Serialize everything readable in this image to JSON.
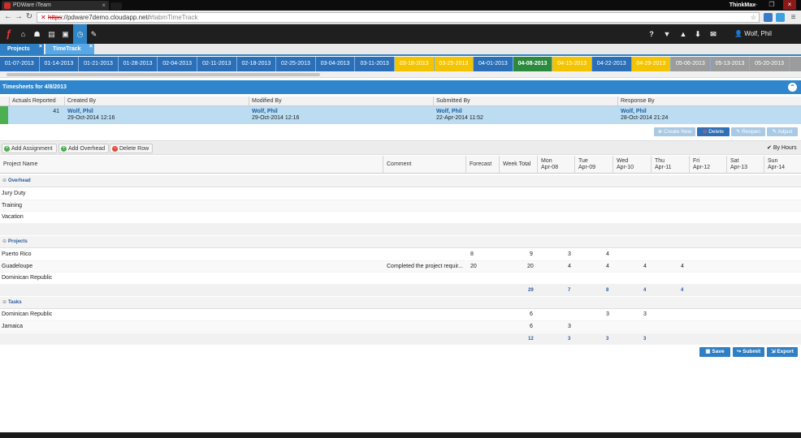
{
  "browser": {
    "tab_title": "PDWare iTeam",
    "profile": "ThinkMax",
    "url_scheme": "https",
    "url_host": "://pdware7demo.cloudapp.net/",
    "url_path": "#tabmTimeTrack"
  },
  "appnav": {
    "help": "?",
    "user": "Wolf, Phil"
  },
  "apptabs": [
    {
      "label": "Projects"
    },
    {
      "label": "TimeTrack"
    }
  ],
  "weeks": [
    {
      "label": "01-07-2013",
      "state": "blue"
    },
    {
      "label": "01-14-2013",
      "state": "blue"
    },
    {
      "label": "01-21-2013",
      "state": "blue"
    },
    {
      "label": "01-28-2013",
      "state": "blue"
    },
    {
      "label": "02-04-2013",
      "state": "blue"
    },
    {
      "label": "02-11-2013",
      "state": "blue"
    },
    {
      "label": "02-18-2013",
      "state": "blue"
    },
    {
      "label": "02-25-2013",
      "state": "blue"
    },
    {
      "label": "03-04-2013",
      "state": "blue"
    },
    {
      "label": "03-11-2013",
      "state": "blue"
    },
    {
      "label": "03-18-2013",
      "state": "yellow"
    },
    {
      "label": "03-25-2013",
      "state": "yellow"
    },
    {
      "label": "04-01-2013",
      "state": "blue"
    },
    {
      "label": "04-08-2013",
      "state": "green"
    },
    {
      "label": "04-15-2013",
      "state": "yellow"
    },
    {
      "label": "04-22-2013",
      "state": "blue"
    },
    {
      "label": "04-29-2013",
      "state": "yellow"
    },
    {
      "label": "05-06-2013",
      "state": "gray"
    },
    {
      "label": "05-13-2013",
      "state": "gray"
    },
    {
      "label": "05-20-2013",
      "state": "gray"
    },
    {
      "label": "05-2",
      "state": "gray"
    }
  ],
  "timesheet": {
    "title": "Timesheets for 4/8/2013",
    "headers": {
      "actuals": "Actuals Reported",
      "created": "Created By",
      "modified": "Modified By",
      "submitted": "Submitted By",
      "response": "Response By"
    },
    "row": {
      "actuals": "41",
      "created_by": "Wolf, Phil",
      "created_at": "29-Oct-2014 12:16",
      "modified_by": "Wolf, Phil",
      "modified_at": "29-Oct-2014 12:16",
      "submitted_by": "Wolf, Phil",
      "submitted_at": "22-Apr-2014 11:52",
      "response_by": "Wolf, Phil",
      "response_at": "28-Oct-2014 21:24"
    }
  },
  "actions": {
    "create_new": "Create New",
    "delete": "Delete",
    "reopen": "Reopen",
    "adjust": "Adjust"
  },
  "toolbar": {
    "add_assignment": "Add Assignment",
    "add_overhead": "Add Overhead",
    "delete_row": "Delete Row",
    "by_hours": "By Hours"
  },
  "grid": {
    "headers": {
      "project": "Project Name",
      "comment": "Comment",
      "forecast": "Forecast",
      "week_total": "Week Total"
    },
    "days": [
      {
        "dow": "Mon",
        "date": "Apr-08"
      },
      {
        "dow": "Tue",
        "date": "Apr-09"
      },
      {
        "dow": "Wed",
        "date": "Apr-10"
      },
      {
        "dow": "Thu",
        "date": "Apr-11"
      },
      {
        "dow": "Fri",
        "date": "Apr-12"
      },
      {
        "dow": "Sat",
        "date": "Apr-13"
      },
      {
        "dow": "Sun",
        "date": "Apr-14"
      }
    ],
    "groups": {
      "overhead": {
        "label": "Overhead",
        "rows": [
          {
            "name": "Jury Duty"
          },
          {
            "name": "Training"
          },
          {
            "name": "Vacation"
          }
        ]
      },
      "projects": {
        "label": "Projects",
        "rows": [
          {
            "name": "Puerto Rico",
            "comment": "",
            "forecast": "8",
            "total": "9",
            "mon": "",
            "tue": "3",
            "wed": "4",
            "thu": "",
            "fri": ""
          },
          {
            "name": "Guadeloupe",
            "comment": "Completed the project requir...",
            "forecast": "20",
            "total": "20",
            "mon": "",
            "tue": "4",
            "wed": "4",
            "thu": "4",
            "fri": "4"
          },
          {
            "name": "Dominican Republic",
            "comment": "",
            "forecast": "",
            "total": "",
            "mon": "",
            "tue": "",
            "wed": "",
            "thu": "",
            "fri": ""
          }
        ],
        "totals": {
          "total": "29",
          "tue": "7",
          "wed": "8",
          "thu": "4",
          "fri": "4"
        }
      },
      "tasks": {
        "label": "Tasks",
        "rows": [
          {
            "name": "Dominican Republic",
            "total": "6",
            "tue": "",
            "wed": "3",
            "thu": "3"
          },
          {
            "name": "Jamaica",
            "total": "6",
            "tue": "3",
            "wed": "",
            "thu": ""
          }
        ],
        "totals": {
          "total": "12",
          "tue": "3",
          "wed": "3",
          "thu": "3"
        }
      }
    }
  },
  "footer": {
    "save": "Save",
    "submit": "Submit",
    "export": "Export"
  },
  "colors": {
    "accent": "#2f86cc",
    "yellow_week": "#f5c400",
    "green_week": "#2b8a3e",
    "gray_week": "#9c9c9c",
    "selected_row": "#bcdcf2"
  }
}
